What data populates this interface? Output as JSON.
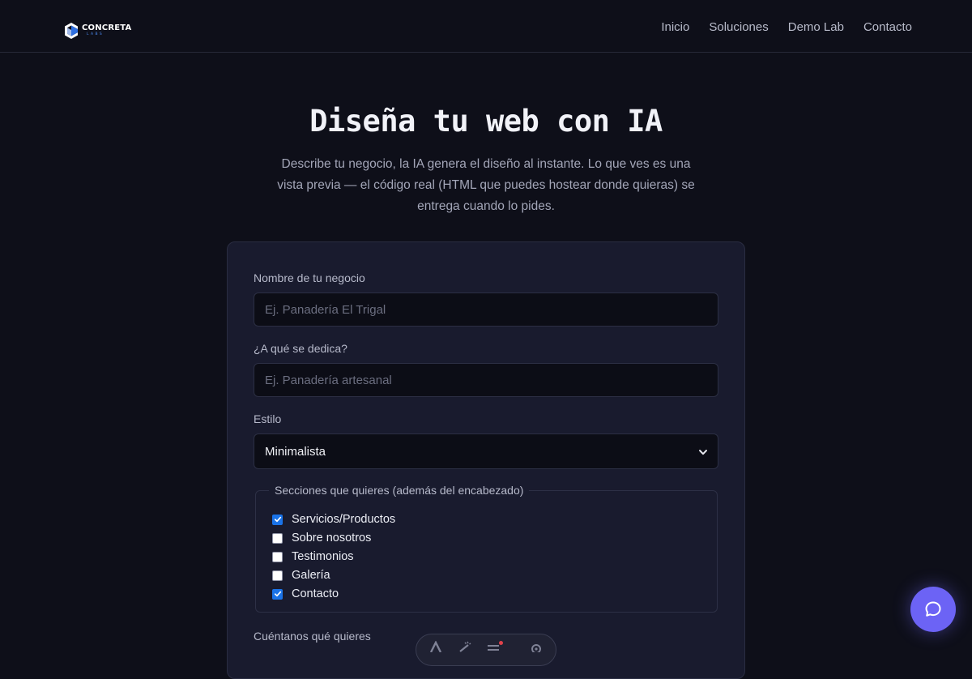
{
  "brand": {
    "name": "CONCRETA",
    "sub": "LABS",
    "colors": {
      "primary": "#ffffff",
      "accent": "#4b8bf5"
    }
  },
  "nav": {
    "items": [
      {
        "label": "Inicio"
      },
      {
        "label": "Soluciones"
      },
      {
        "label": "Demo Lab"
      },
      {
        "label": "Contacto"
      }
    ]
  },
  "hero": {
    "title": "Diseña tu web con IA",
    "description": "Describe tu negocio, la IA genera el diseño al instante. Lo que ves es una vista previa — el código real (HTML que puedes hostear donde quieras) se entrega cuando lo pides."
  },
  "form": {
    "business_name": {
      "label": "Nombre de tu negocio",
      "value": "",
      "placeholder": "Ej. Panadería El Trigal"
    },
    "activity": {
      "label": "¿A qué se dedica?",
      "value": "",
      "placeholder": "Ej. Panadería artesanal"
    },
    "style": {
      "label": "Estilo",
      "selected": "Minimalista"
    },
    "sections": {
      "legend": "Secciones que quieres (además del encabezado)",
      "options": [
        {
          "label": "Servicios/Productos",
          "checked": true
        },
        {
          "label": "Sobre nosotros",
          "checked": false
        },
        {
          "label": "Testimonios",
          "checked": false
        },
        {
          "label": "Galería",
          "checked": false
        },
        {
          "label": "Contacto",
          "checked": true
        }
      ]
    },
    "details": {
      "label": "Cuéntanos qué quieres"
    }
  },
  "toolbar": {
    "icons": [
      "text-icon",
      "magic-wand-icon",
      "lines-icon",
      "gear-icon"
    ]
  },
  "chat": {
    "icon": "chat-bubble-icon",
    "color": "#6c63f5"
  }
}
